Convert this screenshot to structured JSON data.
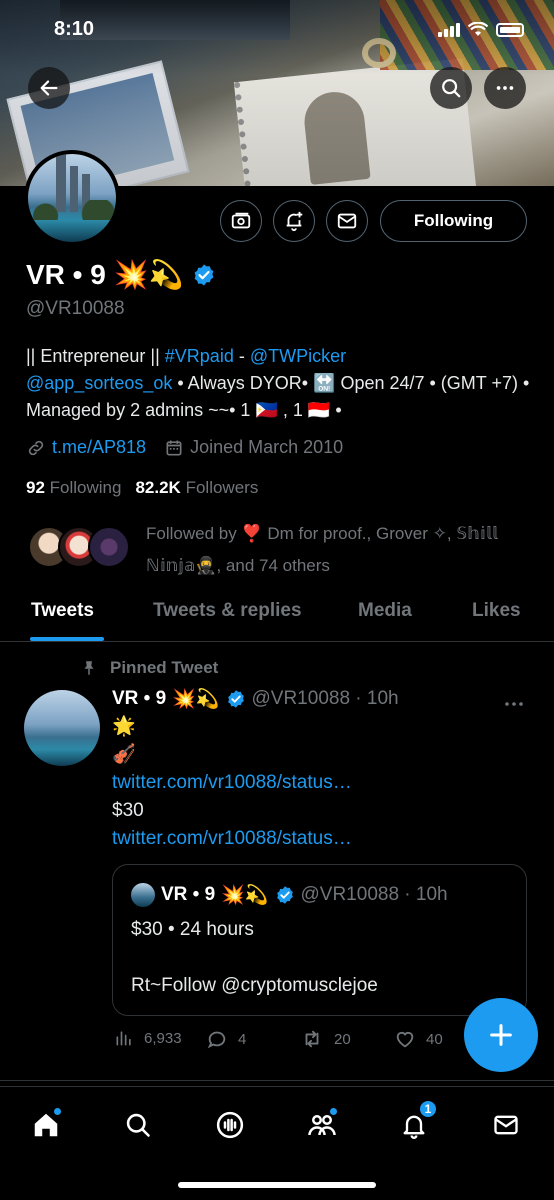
{
  "status_bar": {
    "time": "8:10"
  },
  "profile": {
    "name": "VR • 9",
    "name_emojis": "💥💫",
    "handle": "@VR10088",
    "following_label": "Following",
    "bio": {
      "p1": "|| Entrepreneur || ",
      "hashtag": "#VRpaid",
      "p2": " - ",
      "mention1": "@TWPicker",
      "mention2": "@app_sorteos_ok",
      "p3": " • Always DYOR• ",
      "on_emoji": "🔛",
      "p4": " Open 24/7 • (GMT +7) • Managed by 2 admins ~~• 1 ",
      "flag_ph": "🇵🇭",
      "p5": " , 1 ",
      "flag_id": "🇮🇩",
      "p6": " •"
    },
    "link": "t.me/AP818",
    "joined": "Joined March 2010",
    "following_count": "92",
    "following_word": "Following",
    "followers_count": "82.2K",
    "followers_word": "Followers",
    "followed_by": "Followed by ❣️ Dm for proof., Grover ✧, 𝕊𝕙𝕚𝕝𝕝 ℕ𝕚𝕟𝕛𝕒🥷, and 74 others"
  },
  "tabs": [
    "Tweets",
    "Tweets & replies",
    "Media",
    "Likes"
  ],
  "tweet": {
    "pinned_label": "Pinned Tweet",
    "name": "VR • 9",
    "name_emojis": "💥💫",
    "handle_time": "@VR10088 · 10h",
    "line1": "🌟",
    "line2": "🎻",
    "link1": "twitter.com/vr10088/status…",
    "price": "$30",
    "link2": "twitter.com/vr10088/status…",
    "quote": {
      "name": "VR • 9",
      "name_emojis": "💥💫",
      "handle_time": "@VR10088 · 10h",
      "line1": "$30 • 24 hours",
      "line2": "Rt~Follow @cryptomusclejoe"
    },
    "views": "6,933",
    "replies": "4",
    "retweets": "20",
    "likes": "40"
  },
  "nav": {
    "notifications_badge": "1"
  },
  "colors": {
    "accent": "#1d9bf0",
    "muted": "#71767b",
    "border": "#2f3336"
  }
}
